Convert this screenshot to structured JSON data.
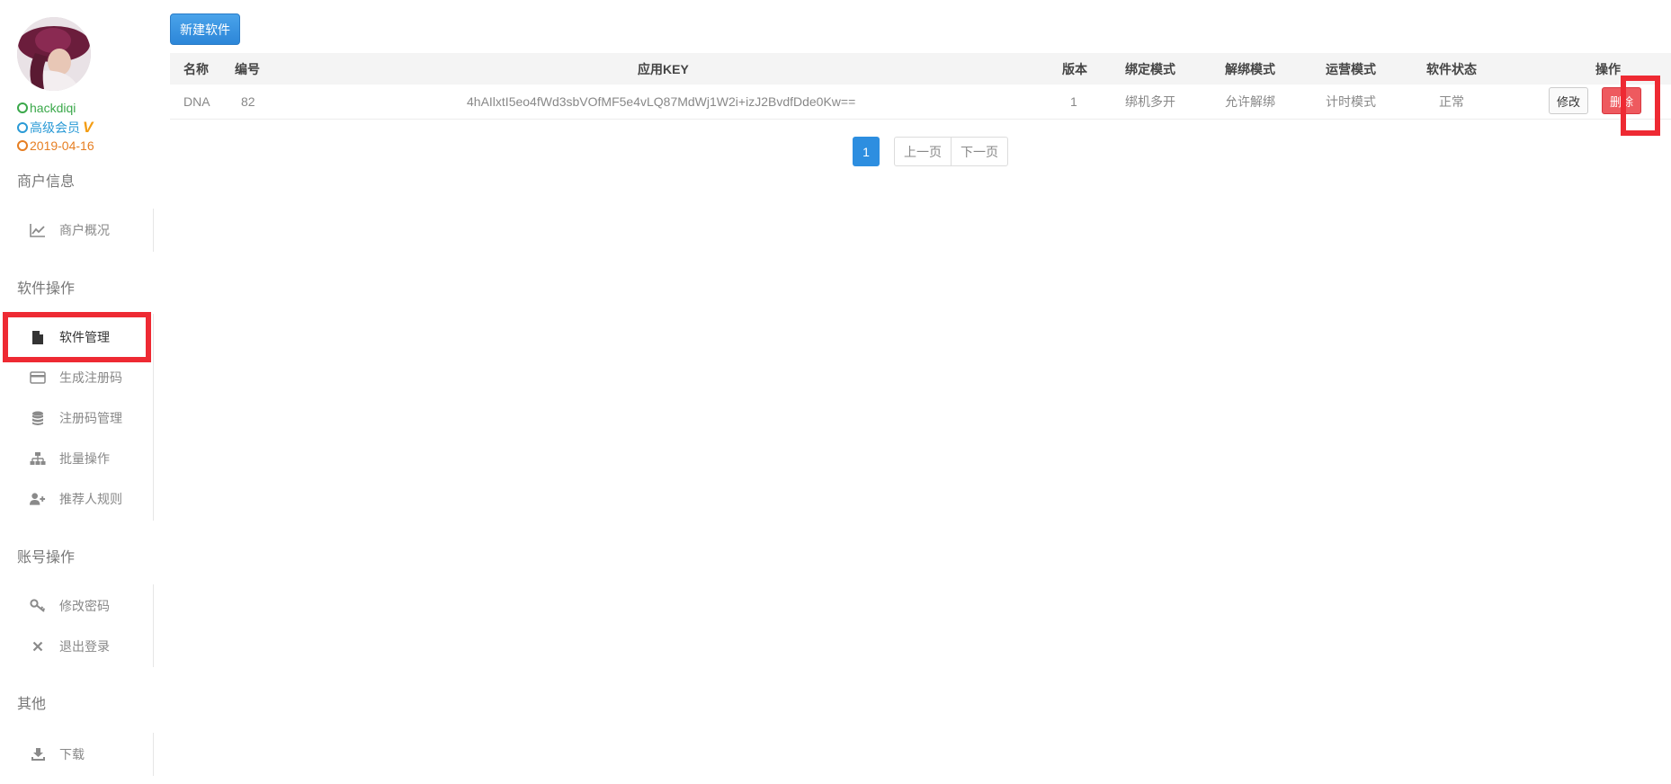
{
  "user": {
    "name": "hackdiqi",
    "level": "高级会员",
    "vip_mark": "V",
    "date": "2019-04-16",
    "colors": {
      "name": "#3aa84a",
      "level": "#2a9ad6",
      "date": "#e67e22"
    }
  },
  "sidebar": {
    "sections": [
      {
        "title": "商户信息",
        "items": [
          {
            "label": "商户概况",
            "icon": "line-chart-icon"
          }
        ]
      },
      {
        "title": "软件操作",
        "items": [
          {
            "label": "软件管理",
            "icon": "file-icon",
            "active": true
          },
          {
            "label": "生成注册码",
            "icon": "credit-card-icon"
          },
          {
            "label": "注册码管理",
            "icon": "database-icon"
          },
          {
            "label": "批量操作",
            "icon": "sitemap-icon"
          },
          {
            "label": "推荐人规则",
            "icon": "user-plus-icon"
          }
        ]
      },
      {
        "title": "账号操作",
        "items": [
          {
            "label": "修改密码",
            "icon": "key-icon"
          },
          {
            "label": "退出登录",
            "icon": "close-icon"
          }
        ]
      },
      {
        "title": "其他",
        "items": [
          {
            "label": "下载",
            "icon": "download-icon"
          }
        ]
      }
    ]
  },
  "toolbar": {
    "new_label": "新建软件"
  },
  "table": {
    "headers": [
      "名称",
      "编号",
      "应用KEY",
      "版本",
      "绑定模式",
      "解绑模式",
      "运营模式",
      "软件状态",
      "操作"
    ],
    "rows": [
      {
        "name": "DNA",
        "id": "82",
        "key": "4hAIlxtI5eo4fWd3sbVOfMF5e4vLQ87MdWj1W2i+izJ2BvdfDde0Kw==",
        "version": "1",
        "bind_mode": "绑机多开",
        "unbind_mode": "允许解绑",
        "op_mode": "计时模式",
        "status": "正常",
        "edit_label": "修改",
        "delete_label": "删除"
      }
    ]
  },
  "pagination": {
    "current": "1",
    "prev_label": "上一页",
    "next_label": "下一页"
  },
  "highlight_color": "#ee2a33"
}
